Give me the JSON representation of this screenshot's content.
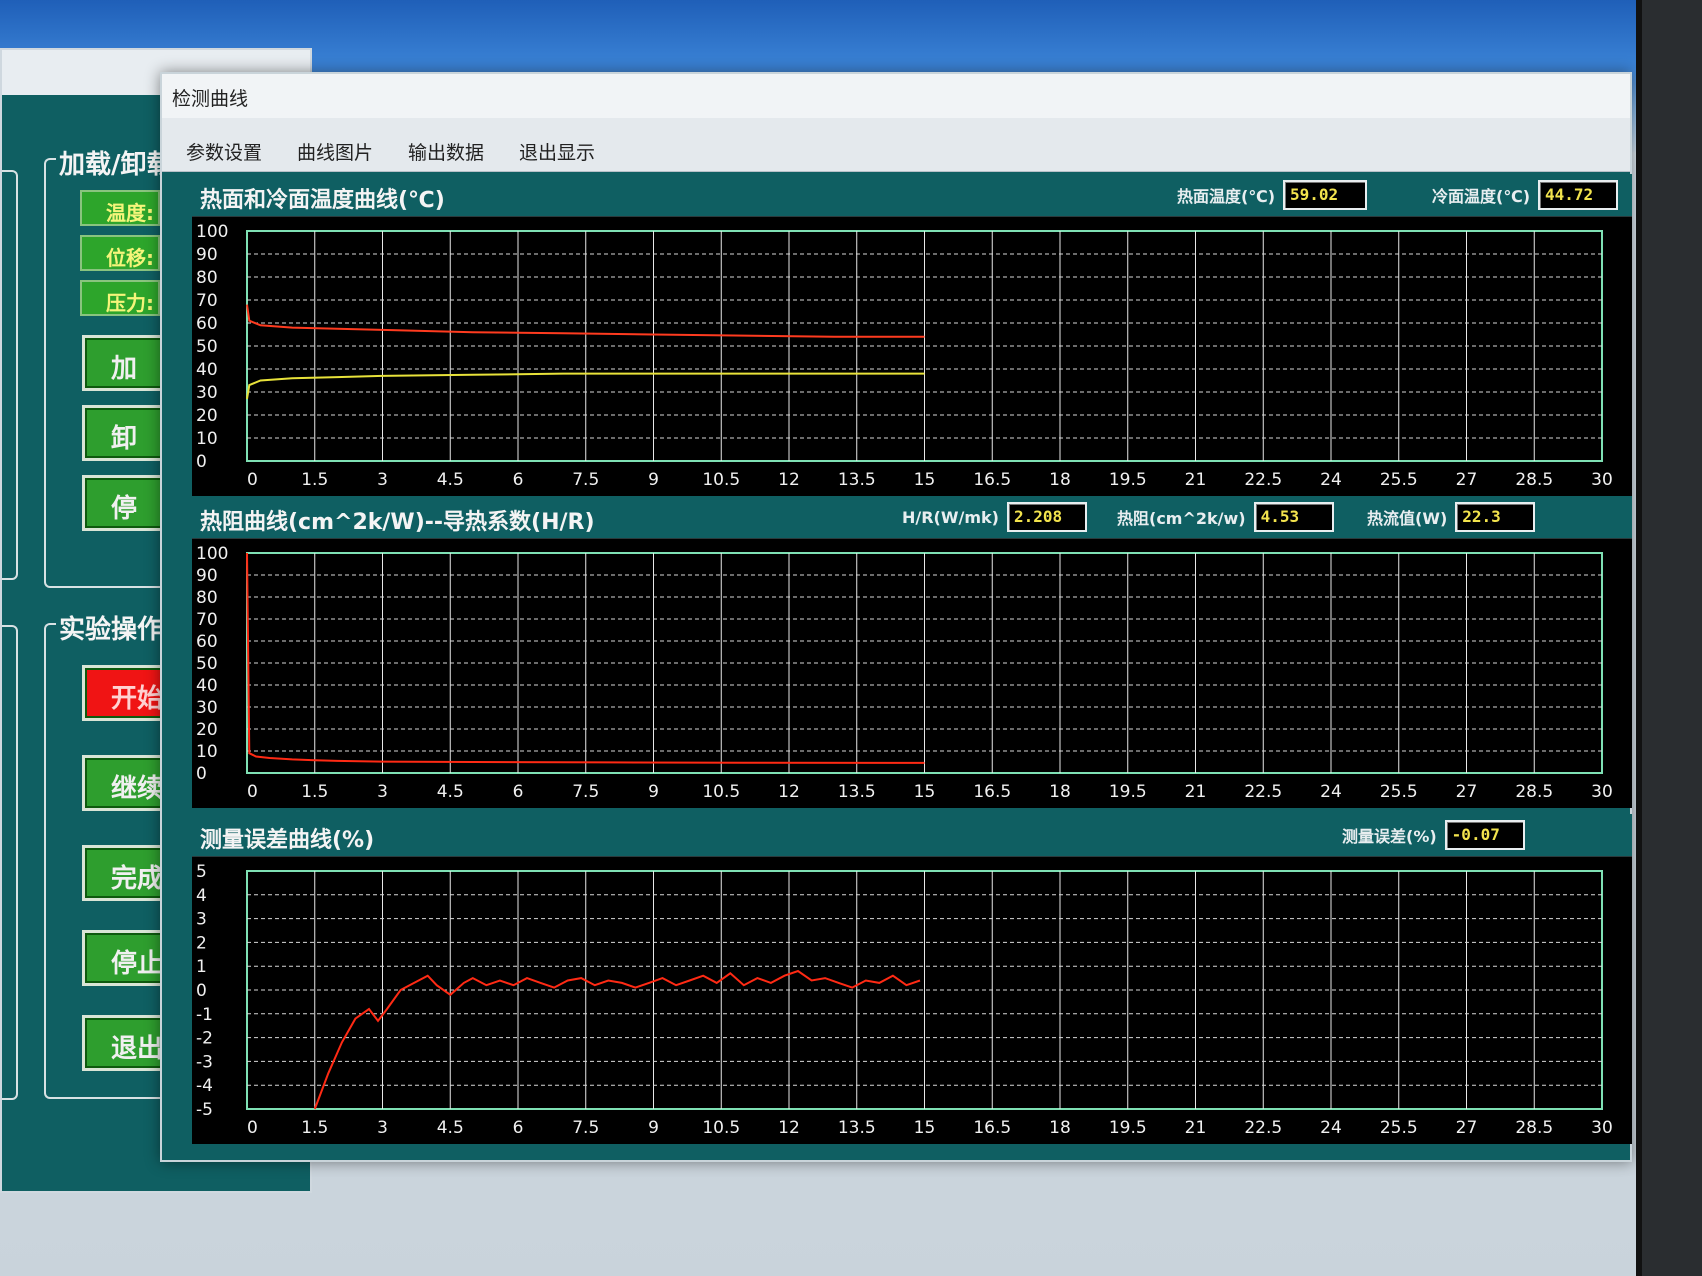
{
  "window": {
    "title": "检测曲线",
    "menu": [
      "参数设置",
      "曲线图片",
      "输出数据",
      "退出显示"
    ]
  },
  "background_app": {
    "groups": [
      "加载/卸载",
      "实验操作"
    ],
    "labels": [
      "温度:",
      "位移:",
      "压力:"
    ],
    "buttons_upper": [
      "加",
      "卸",
      "停"
    ],
    "buttons_lower": [
      "开始",
      "继续",
      "完成",
      "停止",
      "退出"
    ]
  },
  "charts": [
    {
      "title": "热面和冷面温度曲线(℃)",
      "readouts": [
        {
          "label": "热面温度(℃)",
          "value": "59.02"
        },
        {
          "label": "冷面温度(℃)",
          "value": "44.72"
        }
      ]
    },
    {
      "title": "热阻曲线(cm^2k/W)--导热系数(H/R)",
      "readouts": [
        {
          "label": "H/R(W/mk)",
          "value": "2.208"
        },
        {
          "label": "热阻(cm^2k/w)",
          "value": "4.53"
        },
        {
          "label": "热流值(W)",
          "value": "22.3"
        }
      ]
    },
    {
      "title": "测量误差曲线(%)",
      "readouts": [
        {
          "label": "测量误差(%)",
          "value": "-0.07"
        }
      ]
    }
  ],
  "chart_data": [
    {
      "type": "line",
      "title": "热面和冷面温度曲线(℃)",
      "x_ticks": [
        "0",
        "1.5",
        "3",
        "4.5",
        "6",
        "7.5",
        "9",
        "10.5",
        "12",
        "13.5",
        "15",
        "16.5",
        "18",
        "19.5",
        "21",
        "22.5",
        "24",
        "25.5",
        "27",
        "28.5",
        "30"
      ],
      "y_ticks": [
        "0",
        "10",
        "20",
        "30",
        "40",
        "50",
        "60",
        "70",
        "80",
        "90",
        "100"
      ],
      "xlim": [
        0,
        30
      ],
      "ylim": [
        0,
        100
      ],
      "grid": true,
      "series": [
        {
          "color": "#ff3b1f",
          "x": [
            0,
            0.05,
            0.3,
            1,
            2,
            3,
            5,
            7,
            9,
            11,
            13,
            15
          ],
          "y": [
            68,
            61,
            59,
            58,
            57.5,
            57,
            56,
            55.5,
            55,
            54.5,
            54,
            54
          ]
        },
        {
          "color": "#e8e23a",
          "x": [
            0,
            0.05,
            0.3,
            1,
            2,
            3,
            5,
            7,
            9,
            11,
            13,
            15
          ],
          "y": [
            27,
            33,
            35,
            36,
            36.5,
            37,
            37.5,
            38,
            38,
            38,
            38,
            38
          ]
        }
      ]
    },
    {
      "type": "line",
      "title": "热阻曲线(cm^2k/W)--导热系数(H/R)",
      "x_ticks": [
        "0",
        "1.5",
        "3",
        "4.5",
        "6",
        "7.5",
        "9",
        "10.5",
        "12",
        "13.5",
        "15",
        "16.5",
        "18",
        "19.5",
        "21",
        "22.5",
        "24",
        "25.5",
        "27",
        "28.5",
        "30"
      ],
      "y_ticks": [
        "0",
        "10",
        "20",
        "30",
        "40",
        "50",
        "60",
        "70",
        "80",
        "90",
        "100"
      ],
      "xlim": [
        0,
        30
      ],
      "ylim": [
        0,
        100
      ],
      "grid": true,
      "series": [
        {
          "color": "#ff2a14",
          "x": [
            0,
            0.05,
            0.2,
            0.5,
            1,
            1.5,
            2,
            3,
            5,
            8,
            11,
            15
          ],
          "y": [
            100,
            9,
            7.5,
            6.8,
            6.2,
            5.8,
            5.5,
            5.2,
            5,
            4.8,
            4.7,
            4.6
          ]
        }
      ]
    },
    {
      "type": "line",
      "title": "测量误差曲线(%)",
      "x_ticks": [
        "0",
        "1.5",
        "3",
        "4.5",
        "6",
        "7.5",
        "9",
        "10.5",
        "12",
        "13.5",
        "15",
        "16.5",
        "18",
        "19.5",
        "21",
        "22.5",
        "24",
        "25.5",
        "27",
        "28.5",
        "30"
      ],
      "y_ticks": [
        "-5",
        "-4",
        "-3",
        "-2",
        "-1",
        "0",
        "1",
        "2",
        "3",
        "4",
        "5"
      ],
      "xlim": [
        0,
        30
      ],
      "ylim": [
        -5,
        5
      ],
      "grid": true,
      "series": [
        {
          "color": "#ff2a14",
          "x": [
            1.5,
            1.8,
            2.1,
            2.4,
            2.7,
            2.9,
            3.1,
            3.4,
            3.7,
            4.0,
            4.2,
            4.5,
            4.8,
            5.0,
            5.3,
            5.6,
            5.9,
            6.2,
            6.5,
            6.8,
            7.1,
            7.4,
            7.7,
            8.0,
            8.3,
            8.6,
            8.9,
            9.2,
            9.5,
            9.8,
            10.1,
            10.4,
            10.7,
            11.0,
            11.3,
            11.6,
            11.9,
            12.2,
            12.5,
            12.8,
            13.1,
            13.4,
            13.7,
            14.0,
            14.3,
            14.6,
            14.9
          ],
          "y": [
            -5,
            -3.5,
            -2.2,
            -1.2,
            -0.8,
            -1.3,
            -0.8,
            0,
            0.3,
            0.6,
            0.2,
            -0.2,
            0.3,
            0.5,
            0.2,
            0.4,
            0.2,
            0.5,
            0.3,
            0.1,
            0.4,
            0.5,
            0.2,
            0.4,
            0.3,
            0.1,
            0.3,
            0.5,
            0.2,
            0.4,
            0.6,
            0.3,
            0.7,
            0.2,
            0.5,
            0.3,
            0.6,
            0.8,
            0.4,
            0.5,
            0.3,
            0.1,
            0.4,
            0.3,
            0.6,
            0.2,
            0.4
          ]
        }
      ]
    }
  ]
}
